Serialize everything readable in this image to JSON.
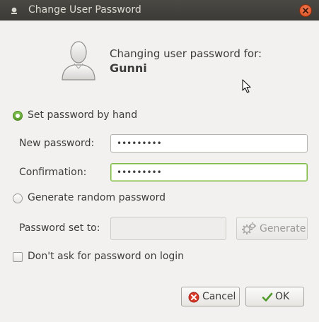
{
  "window": {
    "title": "Change User Password"
  },
  "header": {
    "heading": "Changing user password for:",
    "username": "Gunni"
  },
  "options": {
    "set_by_hand": {
      "label": "Set password by hand",
      "selected": true
    },
    "generate_random": {
      "label": "Generate random password",
      "selected": false
    }
  },
  "fields": {
    "new_password": {
      "label": "New password:",
      "value": "•••••••••"
    },
    "confirmation": {
      "label": "Confirmation:",
      "value": "•••••••••"
    },
    "password_set_to": {
      "label": "Password set to:",
      "value": ""
    }
  },
  "generate_button": {
    "label": "Generate",
    "icon": "gears-icon",
    "enabled": false
  },
  "dont_ask": {
    "label": "Don't ask for password on login",
    "checked": false
  },
  "buttons": {
    "cancel": {
      "label": "Cancel",
      "icon": "cancel-icon"
    },
    "ok": {
      "label": "OK",
      "icon": "checkmark-icon"
    }
  },
  "colors": {
    "titlebar": "#3c3b37",
    "accent_green": "#5e9f30",
    "close_button": "#e9561f"
  }
}
